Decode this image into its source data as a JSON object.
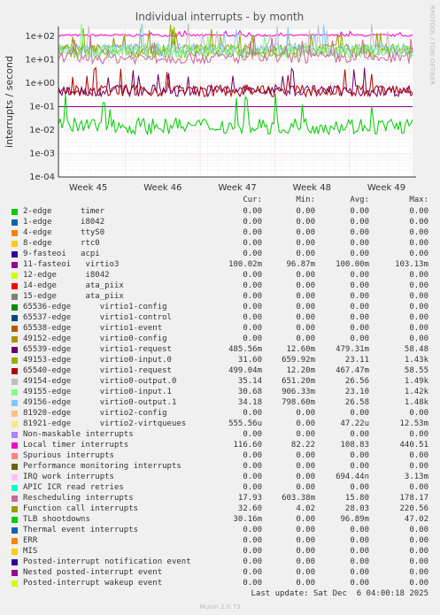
{
  "chart_data": {
    "type": "line",
    "title": "Individual interrupts - by month",
    "ylabel": "interrupts / second",
    "yscale": "log",
    "ylim": [
      0.0001,
      200
    ],
    "yticks": [
      "1e+02",
      "1e+01",
      "1e+00",
      "1e-01",
      "1e-02",
      "1e-03",
      "1e-04"
    ],
    "xticks": [
      "Week 45",
      "Week 46",
      "Week 47",
      "Week 48",
      "Week 49"
    ],
    "grid": true,
    "legend_position": "bottom",
    "series": [
      {
        "name": "2-edge      timer",
        "color": "#00cc00",
        "cur": "0.00",
        "min": "0.00",
        "avg": "0.00",
        "max": "0.00"
      },
      {
        "name": "1-edge      i8042",
        "color": "#0066b3",
        "cur": "0.00",
        "min": "0.00",
        "avg": "0.00",
        "max": "0.00"
      },
      {
        "name": "4-edge      ttyS0",
        "color": "#ff8000",
        "cur": "0.00",
        "min": "0.00",
        "avg": "0.00",
        "max": "0.00"
      },
      {
        "name": "8-edge      rtc0",
        "color": "#ffcc00",
        "cur": "0.00",
        "min": "0.00",
        "avg": "0.00",
        "max": "0.00"
      },
      {
        "name": "9-fasteoi   acpi",
        "color": "#330099",
        "cur": "0.00",
        "min": "0.00",
        "avg": "0.00",
        "max": "0.00"
      },
      {
        "name": "11-fasteoi   virtio3",
        "color": "#990099",
        "cur": "100.02m",
        "min": "96.87m",
        "avg": "100.00m",
        "max": "103.13m"
      },
      {
        "name": "12-edge      i8042",
        "color": "#ccff00",
        "cur": "0.00",
        "min": "0.00",
        "avg": "0.00",
        "max": "0.00"
      },
      {
        "name": "14-edge      ata_piix",
        "color": "#ff0000",
        "cur": "0.00",
        "min": "0.00",
        "avg": "0.00",
        "max": "0.00"
      },
      {
        "name": "15-edge      ata_piix",
        "color": "#808080",
        "cur": "0.00",
        "min": "0.00",
        "avg": "0.00",
        "max": "0.00"
      },
      {
        "name": "65536-edge      virtio1-config",
        "color": "#008f00",
        "cur": "0.00",
        "min": "0.00",
        "avg": "0.00",
        "max": "0.00"
      },
      {
        "name": "65537-edge      virtio1-control",
        "color": "#00487d",
        "cur": "0.00",
        "min": "0.00",
        "avg": "0.00",
        "max": "0.00"
      },
      {
        "name": "65538-edge      virtio1-event",
        "color": "#b35a00",
        "cur": "0.00",
        "min": "0.00",
        "avg": "0.00",
        "max": "0.00"
      },
      {
        "name": "49152-edge      virtio0-config",
        "color": "#b38f00",
        "cur": "0.00",
        "min": "0.00",
        "avg": "0.00",
        "max": "0.00"
      },
      {
        "name": "65539-edge      virtio1-request",
        "color": "#6b006b",
        "cur": "485.56m",
        "min": "12.60m",
        "avg": "479.31m",
        "max": "58.48"
      },
      {
        "name": "49153-edge      virtio0-input.0",
        "color": "#8fb300",
        "cur": "31.60",
        "min": "659.92m",
        "avg": "23.11",
        "max": "1.43k"
      },
      {
        "name": "65540-edge      virtio1-request",
        "color": "#b30000",
        "cur": "499.04m",
        "min": "12.20m",
        "avg": "467.47m",
        "max": "58.55"
      },
      {
        "name": "49154-edge      virtio0-output.0",
        "color": "#bebebe",
        "cur": "35.14",
        "min": "651.20m",
        "avg": "26.56",
        "max": "1.49k"
      },
      {
        "name": "49155-edge      virtio0-input.1",
        "color": "#80ff80",
        "cur": "30.68",
        "min": "906.33m",
        "avg": "23.10",
        "max": "1.42k"
      },
      {
        "name": "49156-edge      virtio0-output.1",
        "color": "#80c9ff",
        "cur": "34.18",
        "min": "798.60m",
        "avg": "26.58",
        "max": "1.48k"
      },
      {
        "name": "81920-edge      virtio2-config",
        "color": "#ffc080",
        "cur": "0.00",
        "min": "0.00",
        "avg": "0.00",
        "max": "0.00"
      },
      {
        "name": "81921-edge      virtio2-virtqueues",
        "color": "#ffe680",
        "cur": "555.56u",
        "min": "0.00",
        "avg": "47.22u",
        "max": "12.53m"
      },
      {
        "name": "Non-maskable interrupts",
        "color": "#aa80ff",
        "cur": "0.00",
        "min": "0.00",
        "avg": "0.00",
        "max": "0.00"
      },
      {
        "name": "Local timer interrupts",
        "color": "#ee00cc",
        "cur": "116.60",
        "min": "82.22",
        "avg": "108.83",
        "max": "440.51"
      },
      {
        "name": "Spurious interrupts",
        "color": "#ff8080",
        "cur": "0.00",
        "min": "0.00",
        "avg": "0.00",
        "max": "0.00"
      },
      {
        "name": "Performance monitoring interrupts",
        "color": "#666600",
        "cur": "0.00",
        "min": "0.00",
        "avg": "0.00",
        "max": "0.00"
      },
      {
        "name": "IRQ work interrupts",
        "color": "#ffbfff",
        "cur": "0.00",
        "min": "0.00",
        "avg": "694.44n",
        "max": "3.13m"
      },
      {
        "name": "APIC ICR read retries",
        "color": "#00ffcc",
        "cur": "0.00",
        "min": "0.00",
        "avg": "0.00",
        "max": "0.00"
      },
      {
        "name": "Rescheduling interrupts",
        "color": "#cc6699",
        "cur": "17.93",
        "min": "603.38m",
        "avg": "15.80",
        "max": "178.17"
      },
      {
        "name": "Function call interrupts",
        "color": "#999900",
        "cur": "32.60",
        "min": "4.02",
        "avg": "28.03",
        "max": "220.56"
      },
      {
        "name": "TLB shootdowns",
        "color": "#00cc00",
        "cur": "30.16m",
        "min": "0.00",
        "avg": "96.89m",
        "max": "47.02"
      },
      {
        "name": "Thermal event interrupts",
        "color": "#0066b3",
        "cur": "0.00",
        "min": "0.00",
        "avg": "0.00",
        "max": "0.00"
      },
      {
        "name": "ERR",
        "color": "#ff8000",
        "cur": "0.00",
        "min": "0.00",
        "avg": "0.00",
        "max": "0.00"
      },
      {
        "name": "MIS",
        "color": "#ffcc00",
        "cur": "0.00",
        "min": "0.00",
        "avg": "0.00",
        "max": "0.00"
      },
      {
        "name": "Posted-interrupt notification event",
        "color": "#330099",
        "cur": "0.00",
        "min": "0.00",
        "avg": "0.00",
        "max": "0.00"
      },
      {
        "name": "Nested posted-interrupt event",
        "color": "#990099",
        "cur": "0.00",
        "min": "0.00",
        "avg": "0.00",
        "max": "0.00"
      },
      {
        "name": "Posted-interrupt wakeup event",
        "color": "#ccff00",
        "cur": "0.00",
        "min": "0.00",
        "avg": "0.00",
        "max": "0.00"
      }
    ],
    "plotted_lines": [
      {
        "name": "Local timer interrupts",
        "level": 110,
        "noise": 0.05,
        "color": "#ee00cc"
      },
      {
        "name": "49154-edge      virtio0-output.0",
        "level": 27,
        "noise": 0.28,
        "color": "#bebebe"
      },
      {
        "name": "Function call interrupts",
        "level": 28,
        "noise": 0.22,
        "color": "#999900"
      },
      {
        "name": "49153-edge      virtio0-input.0",
        "level": 23,
        "noise": 0.3,
        "color": "#8fb300"
      },
      {
        "name": "49156-edge      virtio0-output.1",
        "level": 26,
        "noise": 0.3,
        "color": "#80c9ff"
      },
      {
        "name": "49155-edge      virtio0-input.1",
        "level": 23,
        "noise": 0.3,
        "color": "#80ff80"
      },
      {
        "name": "Rescheduling interrupts",
        "level": 12,
        "noise": 0.25,
        "color": "#cc6699"
      },
      {
        "name": "65539-edge      virtio1-request",
        "level": 0.48,
        "noise": 0.25,
        "color": "#6b006b"
      },
      {
        "name": "65540-edge      virtio1-request",
        "level": 0.47,
        "noise": 0.25,
        "color": "#b30000"
      },
      {
        "name": "11-fasteoi   virtio3",
        "level": 0.1,
        "noise": 0.0,
        "color": "#990099"
      },
      {
        "name": "TLB shootdowns",
        "level": 0.015,
        "noise": 0.35,
        "color": "#00cc00"
      }
    ]
  },
  "header": {
    "cur": "Cur:",
    "min": "Min:",
    "avg": "Avg:",
    "max": "Max:"
  },
  "side_text": "RRDTOOL / TOBI OETIKER",
  "footer": "Last update: Sat Dec  6 04:00:18 2025",
  "version": "Munin 2.0.73"
}
